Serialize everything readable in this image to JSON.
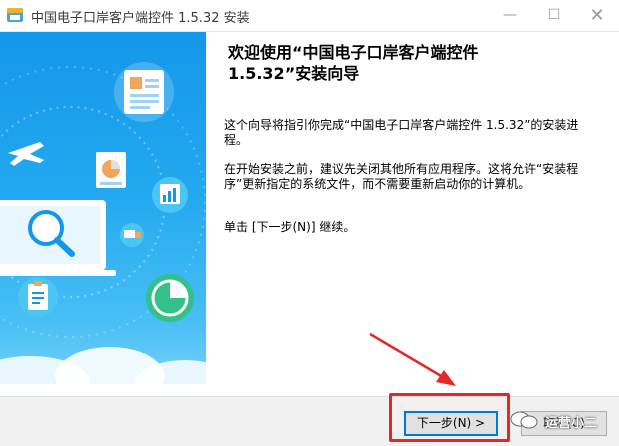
{
  "window": {
    "title": "中国电子口岸客户端控件 1.5.32 安装",
    "minimize_glyph": "—",
    "maximize_glyph": "☐",
    "close_glyph": "✕"
  },
  "content": {
    "heading_line1": "欢迎使用“中国电子口岸客户端控件",
    "heading_line2": "1.5.32”安装向导",
    "paragraph1": "这个向导将指引你完成“中国电子口岸客户端控件 1.5.32”的安装进程。",
    "paragraph2": "在开始安装之前，建议先关闭其他所有应用程序。这将允许“安装程序”更新指定的系统文件，而不需要重新启动你的计算机。",
    "paragraph3": "单击 [下一步(N)] 继续。"
  },
  "footer": {
    "next_label": "下一步(N) >",
    "cancel_label": "取消(C)"
  },
  "watermark": {
    "text": "运营小二"
  },
  "colors": {
    "sidebar_top": "#1497ea",
    "sidebar_bottom": "#7fd4fa",
    "annotation_red": "#e22828",
    "button_focus": "#0078d7"
  },
  "icons": [
    "installer-app-icon",
    "airplane-icon",
    "globe-icon",
    "document-icon",
    "pie-chart-icon",
    "bar-chart-icon",
    "magnifier-icon",
    "clipboard-icon",
    "truck-icon",
    "computer-icon",
    "cloud-icon"
  ]
}
